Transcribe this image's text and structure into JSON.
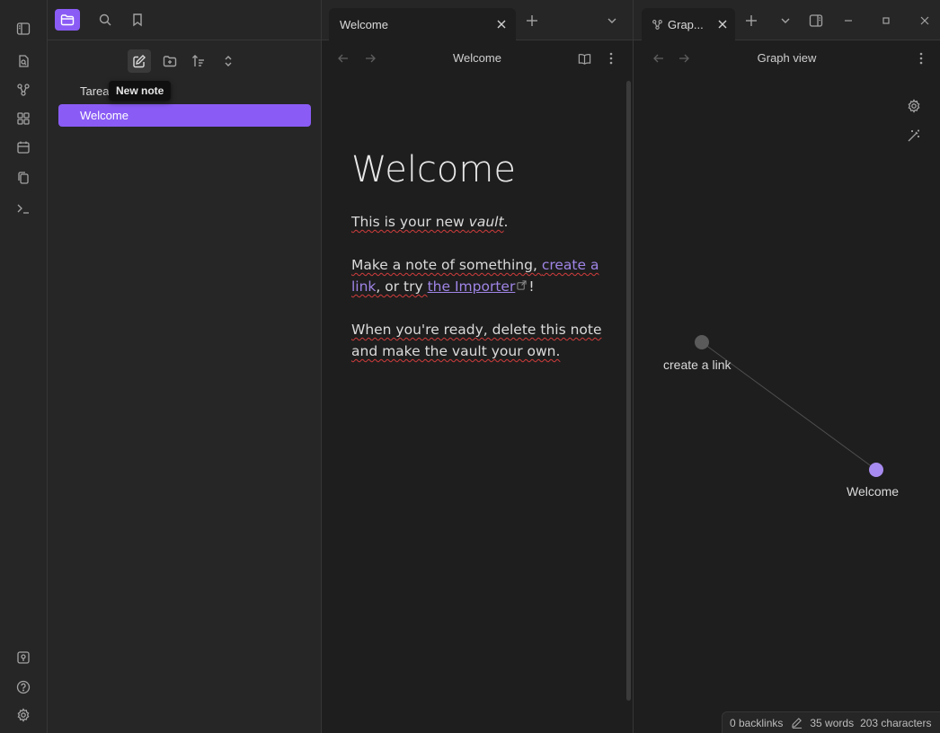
{
  "tooltip": "New note",
  "explorer": {
    "items": [
      {
        "label": "Tarea"
      },
      {
        "label": "Welcome",
        "active": true
      }
    ]
  },
  "editor": {
    "tab_title": "Welcome",
    "view_title": "Welcome",
    "note": {
      "title": "Welcome",
      "p1_prefix": "This is your new ",
      "p1_em": "vault",
      "p1_suffix": ".",
      "p2_prefix": "Make a note of something, ",
      "p2_link": "create a link",
      "p2_mid": ", or try ",
      "p2_extlink": "the Importer",
      "p2_suffix": "!",
      "p3": "When you're ready, delete this note and make the vault your own."
    }
  },
  "graph": {
    "tab_title": "Grap...",
    "view_title": "Graph view",
    "nodes": [
      {
        "label": "create a link",
        "color": "#5a5a5a"
      },
      {
        "label": "Welcome",
        "color": "#a88bf0"
      }
    ]
  },
  "status": {
    "backlinks": "0 backlinks",
    "words": "35 words",
    "characters": "203 characters"
  },
  "colors": {
    "accent": "#8a5cf5",
    "link": "#9f85e6",
    "background": "#1e1e1e",
    "panel": "#262626"
  }
}
